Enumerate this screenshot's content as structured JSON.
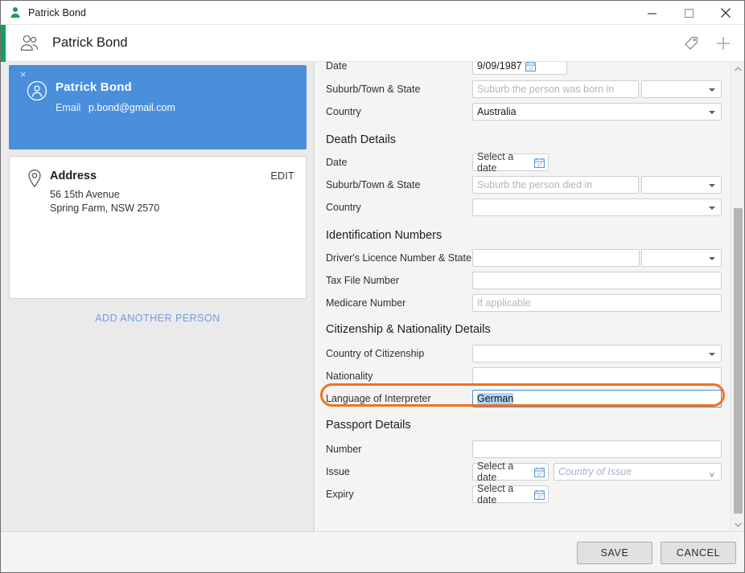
{
  "window": {
    "title": "Patrick Bond",
    "title_icon": "person-icon",
    "minimize": "minimize-icon",
    "maximize": "maximize-icon",
    "close": "close-icon"
  },
  "header": {
    "title": "Patrick Bond",
    "icon": "people-icon",
    "accent_color": "#14a05a",
    "actions": [
      {
        "name": "tag-icon",
        "label": "Tag"
      },
      {
        "name": "add-icon",
        "label": "Add"
      }
    ]
  },
  "sidebar": {
    "person": {
      "name": "Patrick Bond",
      "email_label": "Email",
      "email_value": "p.bond@gmail.com",
      "close": "×",
      "selected_color": "#4a8fdb"
    },
    "address": {
      "title": "Address",
      "edit": "EDIT",
      "line1": "56 15th Avenue",
      "line2": "Spring Farm, NSW 2570"
    },
    "add_person": "ADD ANOTHER PERSON"
  },
  "form": {
    "birth": {
      "date_label": "Date",
      "date_value": "9/09/1987",
      "suburb_label": "Suburb/Town & State",
      "suburb_placeholder": "Suburb the person was born in",
      "state_value": "",
      "country_label": "Country",
      "country_value": "Australia"
    },
    "death": {
      "section": "Death Details",
      "date_label": "Date",
      "date_value": "Select a date",
      "suburb_label": "Suburb/Town & State",
      "suburb_placeholder": "Suburb the person died in",
      "state_value": "",
      "country_label": "Country",
      "country_value": ""
    },
    "identification": {
      "section": "Identification Numbers",
      "licence_label": "Driver's Licence Number & State",
      "licence_value": "",
      "licence_state_value": "",
      "tax_label": "Tax File Number",
      "tax_value": "",
      "medicare_label": "Medicare Number",
      "medicare_placeholder": "If applicable"
    },
    "citizenship": {
      "section": "Citizenship & Nationality Details",
      "country_label": "Country of Citizenship",
      "country_value": "",
      "nationality_label": "Nationality",
      "nationality_value": "",
      "interpreter_label": "Language of Interpreter",
      "interpreter_value": "German",
      "highlight_color": "#f2721c"
    },
    "passport": {
      "section": "Passport Details",
      "number_label": "Number",
      "number_value": "",
      "issue_label": "Issue",
      "issue_date_value": "Select a date",
      "issue_country_placeholder": "Country of Issue",
      "expiry_label": "Expiry",
      "expiry_date_value": "Select a date"
    }
  },
  "footer": {
    "save": "SAVE",
    "cancel": "CANCEL"
  }
}
